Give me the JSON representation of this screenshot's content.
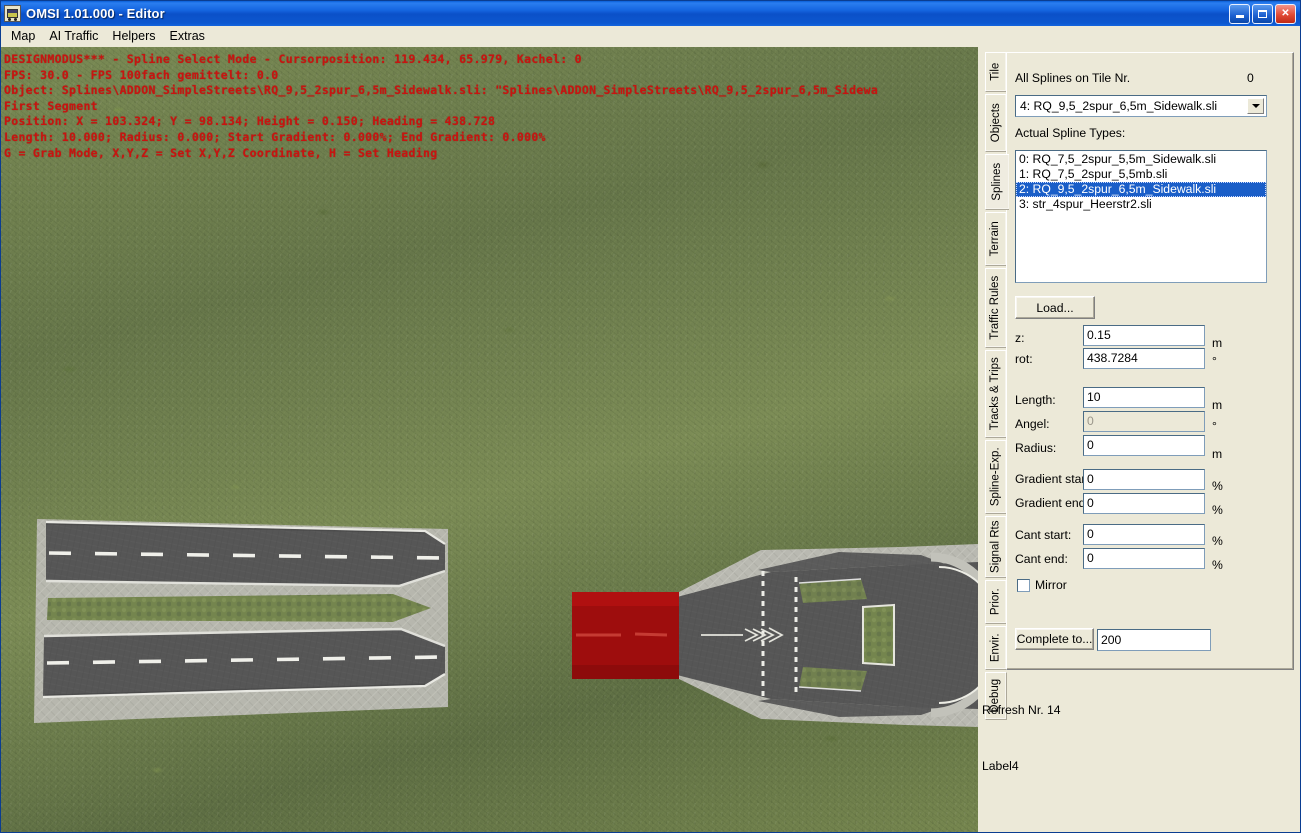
{
  "window": {
    "title": "OMSI 1.01.000 - Editor",
    "icon": "bus-icon",
    "buttons": {
      "minimize": "minimize-button",
      "maximize": "maximize-button",
      "close": "close-button"
    }
  },
  "menubar": {
    "items": [
      {
        "label": "Map"
      },
      {
        "label": "AI Traffic"
      },
      {
        "label": "Helpers"
      },
      {
        "label": "Extras"
      }
    ]
  },
  "viewport": {
    "debug_lines": [
      "DESIGNMODUS*** - Spline Select Mode - Cursorposition: 119.434, 65.979, Kachel: 0",
      "FPS: 30.0 - FPS 100fach gemittelt: 0.0",
      "Object: Splines\\ADDON_SimpleStreets\\RQ_9,5_2spur_6,5m_Sidewalk.sli: \"Splines\\ADDON_SimpleStreets\\RQ_9,5_2spur_6,5m_Sidewa",
      "First Segment",
      "Position: X = 103.324; Y = 98.134; Height = 0.150; Heading = 438.728",
      "Length: 10.000; Radius: 0.000; Start Gradient: 0.000%; End Gradient: 0.000%",
      "G = Grab Mode, X,Y,Z = Set X,Y,Z Coordinate, H = Set Heading"
    ],
    "debug_color": "#c81410",
    "selection_color": "#9e0d0d",
    "road_color": "#555555",
    "sidewalk_color": "#b8b8b0",
    "grass_color": "#70804c"
  },
  "panel": {
    "tabs": [
      {
        "label": "Tile",
        "active": false
      },
      {
        "label": "Objects",
        "active": false
      },
      {
        "label": "Splines",
        "active": true
      },
      {
        "label": "Terrain",
        "active": false
      },
      {
        "label": "Traffic Rules",
        "active": false
      },
      {
        "label": "Tracks & Trips",
        "active": false
      },
      {
        "label": "Spline-Exp.",
        "active": false
      },
      {
        "label": "Signal Rts",
        "active": false
      },
      {
        "label": "Prior.",
        "active": false
      },
      {
        "label": "Envir.",
        "active": false
      },
      {
        "label": "Debug",
        "active": false
      }
    ],
    "all_splines_label": "All Splines on Tile Nr.",
    "all_splines_count": "0",
    "spline_combo_value": "4: RQ_9,5_2spur_6,5m_Sidewalk.sli",
    "actual_types_label": "Actual Spline Types:",
    "spline_types": [
      {
        "text": "0: RQ_7,5_2spur_5,5m_Sidewalk.sli",
        "selected": false
      },
      {
        "text": "1: RQ_7,5_2spur_5,5mb.sli",
        "selected": false
      },
      {
        "text": "2: RQ_9,5_2spur_6,5m_Sidewalk.sli",
        "selected": true
      },
      {
        "text": "3: str_4spur_Heerstr2.sli",
        "selected": false
      }
    ],
    "load_button": "Load...",
    "fields": [
      {
        "label": "z:",
        "value": "0.15",
        "unit": "m",
        "disabled": false
      },
      {
        "label": "rot:",
        "value": "438.7284",
        "unit": "°",
        "disabled": false
      },
      {
        "label": "Length:",
        "value": "10",
        "unit": "m",
        "disabled": false
      },
      {
        "label": "Angel:",
        "value": "0",
        "unit": "°",
        "disabled": true
      },
      {
        "label": "Radius:",
        "value": "0",
        "unit": "m",
        "disabled": false
      },
      {
        "label": "Gradient start:",
        "value": "0",
        "unit": "%",
        "disabled": false
      },
      {
        "label": "Gradient end:",
        "value": "0",
        "unit": "%",
        "disabled": false
      },
      {
        "label": "Cant start:",
        "value": "0",
        "unit": "%",
        "disabled": false
      },
      {
        "label": "Cant end:",
        "value": "0",
        "unit": "%",
        "disabled": false
      }
    ],
    "mirror_label": "Mirror",
    "mirror_checked": false,
    "complete_button": "Complete to...",
    "complete_value": "200",
    "refresh_label": "Refresh Nr. 14",
    "label4": "Label4"
  }
}
